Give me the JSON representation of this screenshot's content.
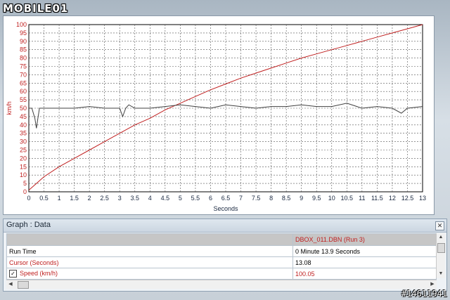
{
  "logo_text": "MOBILE01",
  "watermark": "#14611941",
  "graph": {
    "ylabel": "km/h",
    "xlabel": "Seconds"
  },
  "chart_data": {
    "type": "line",
    "title": "",
    "xlabel": "Seconds",
    "ylabel": "km/h",
    "xlim": [
      0,
      13
    ],
    "ylim": [
      0,
      100
    ],
    "grid": true,
    "x_ticks": [
      0,
      0.5,
      1,
      1.5,
      2,
      2.5,
      3,
      3.5,
      4,
      4.5,
      5,
      5.5,
      6,
      6.5,
      7,
      7.5,
      8,
      8.5,
      9,
      9.5,
      10,
      10.5,
      11,
      11.5,
      12,
      12.5,
      13
    ],
    "y_ticks": [
      0,
      5,
      10,
      15,
      20,
      25,
      30,
      35,
      40,
      45,
      50,
      55,
      60,
      65,
      70,
      75,
      80,
      85,
      90,
      95,
      100
    ],
    "series": [
      {
        "color": "#c02020",
        "x": [
          0,
          0.25,
          0.5,
          1,
          1.5,
          2,
          2.5,
          3,
          3.5,
          4,
          4.5,
          5,
          5.5,
          6,
          6.5,
          7,
          7.5,
          8,
          8.5,
          9,
          9.5,
          10,
          10.5,
          11,
          11.5,
          12,
          12.5,
          13
        ],
        "y": [
          1,
          5,
          9,
          15,
          20,
          25,
          30,
          35,
          40,
          44,
          49,
          53,
          57,
          61,
          64.5,
          68,
          71,
          74,
          77,
          80,
          82.5,
          85,
          87.5,
          90,
          92.5,
          95,
          97.5,
          100
        ]
      },
      {
        "color": "#404040",
        "x": [
          0,
          0.1,
          0.2,
          0.25,
          0.3,
          0.35,
          0.5,
          1,
          1.5,
          2,
          2.5,
          3,
          3.1,
          3.2,
          3.3,
          3.5,
          4,
          4.5,
          5,
          5.5,
          6,
          6.5,
          7,
          7.5,
          8,
          8.5,
          9,
          9.5,
          10,
          10.5,
          11,
          11.5,
          12,
          12.3,
          12.5,
          13
        ],
        "y": [
          50,
          50,
          44,
          38,
          44,
          50,
          50,
          50,
          50,
          51,
          50,
          50,
          45,
          50,
          52,
          50,
          50,
          51,
          52,
          51,
          50,
          52,
          51,
          50,
          51,
          51,
          52,
          51,
          51,
          53,
          50,
          51,
          50,
          47,
          50,
          51
        ]
      }
    ]
  },
  "data_panel": {
    "title": "Graph : Data",
    "header_file": "DBOX_011.DBN (Run 3)",
    "rows": [
      {
        "label": "Run Time",
        "value": "0 Minute 13.9 Seconds"
      },
      {
        "label": "Cursor (Seconds)",
        "value": "13.08"
      },
      {
        "label": "Speed (km/h)",
        "value": "100.05"
      }
    ]
  }
}
